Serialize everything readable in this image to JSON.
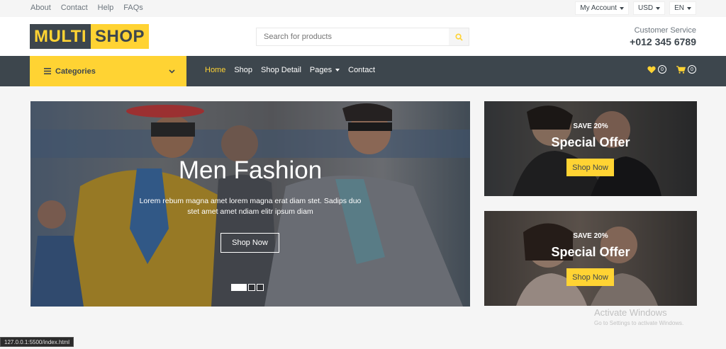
{
  "topbar": {
    "links": [
      "About",
      "Contact",
      "Help",
      "FAQs"
    ],
    "account_label": "My Account",
    "currency_label": "USD",
    "language_label": "EN"
  },
  "header": {
    "logo_part1": "MULTI",
    "logo_part2": "SHOP",
    "search_placeholder": "Search for products",
    "customer_service_label": "Customer Service",
    "phone": "+012 345 6789"
  },
  "nav": {
    "categories_label": "Categories",
    "links": [
      "Home",
      "Shop",
      "Shop Detail",
      "Pages",
      "Contact"
    ],
    "active_index": 0,
    "wishlist_count": "0",
    "cart_count": "0"
  },
  "hero": {
    "title": "Men Fashion",
    "text": "Lorem rebum magna amet lorem magna erat diam stet. Sadips duo stet amet amet ndiam elitr ipsum diam",
    "button_label": "Shop Now",
    "slide_count": 3,
    "active_slide": 0
  },
  "offers": [
    {
      "save_label": "SAVE 20%",
      "title": "Special Offer",
      "button_label": "Shop Now"
    },
    {
      "save_label": "SAVE 20%",
      "title": "Special Offer",
      "button_label": "Shop Now"
    }
  ],
  "watermark": {
    "title": "Activate Windows",
    "subtitle": "Go to Settings to activate Windows."
  },
  "status_url": "127.0.0.1:5500/index.html",
  "colors": {
    "accent": "#ffd333",
    "dark": "#3d464d",
    "light_bg": "#f5f5f5"
  }
}
